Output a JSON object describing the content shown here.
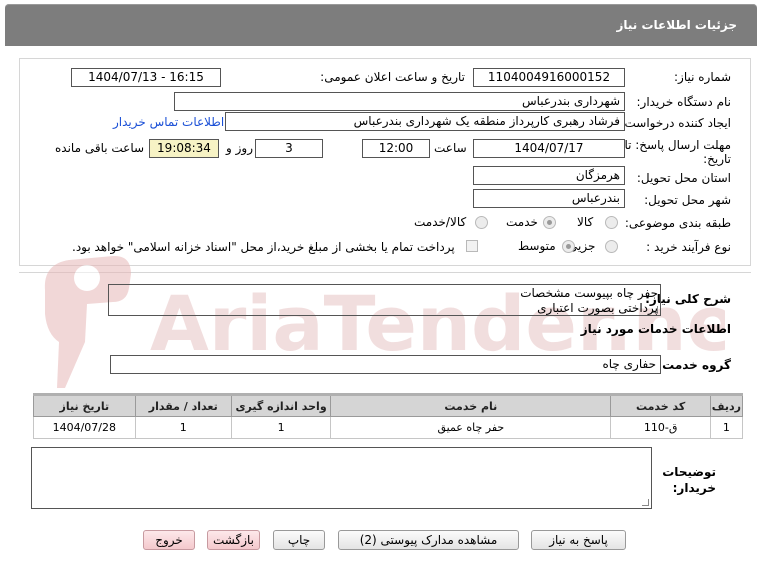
{
  "header": {
    "title": "جزئیات اطلاعات نیاز"
  },
  "form": {
    "need_number_label": "شماره نیاز:",
    "need_number": "1104004916000152",
    "announce_label": "تاریخ و ساعت اعلان عمومی:",
    "announce_value": "1404/07/13 - 16:15",
    "buyer_org_label": "نام دستگاه خریدار:",
    "buyer_org": "شهرداری بندرعباس",
    "creator_label": "ایجاد کننده درخواست:",
    "creator": "فرشاد رهبری کارپرداز منطقه یک شهرداری بندرعباس",
    "contact_link": "اطلاعات تماس خریدار",
    "deadline_label_1": "مهلت ارسال پاسخ: تا",
    "deadline_label_2": "تاریخ:",
    "deadline_date": "1404/07/17",
    "time_label": "ساعت",
    "deadline_time": "12:00",
    "days_value": "3",
    "days_label": "روز و",
    "remaining_time": "19:08:34",
    "remaining_label": "ساعت باقی مانده",
    "province_label": "استان محل تحویل:",
    "province": "هرمزگان",
    "city_label": "شهر محل تحویل:",
    "city": "بندرعباس",
    "category_label": "طبقه بندی موضوعی:",
    "category_options": [
      "کالا",
      "خدمت",
      "کالا/خدمت"
    ],
    "category_selected": "خدمت",
    "process_label": "نوع فرآیند خرید :",
    "process_options": [
      "جزیی",
      "متوسط"
    ],
    "process_selected": "متوسط",
    "payment_note": "پرداخت تمام یا بخشی از مبلغ خرید،از محل \"اسناد خزانه اسلامی\" خواهد بود."
  },
  "details": {
    "summary_label": "شرح کلی نیاز:",
    "summary_line1": "حفر چاه بپیوست مشخصات",
    "summary_line2": "پرداختی بصورت اعتباری",
    "services_title": "اطلاعات خدمات مورد نیاز",
    "group_label": "گروه خدمت:",
    "group_value": "حفاری چاه",
    "buyer_notes_label_1": "توضیحات",
    "buyer_notes_label_2": "خریدار:"
  },
  "table": {
    "headers": [
      "ردیف",
      "کد خدمت",
      "نام خدمت",
      "واحد اندازه گیری",
      "تعداد / مقدار",
      "تاریخ نیاز"
    ],
    "rows": [
      [
        "1",
        "ق-110",
        "حفر چاه عمیق",
        "1",
        "1",
        "1404/07/28"
      ]
    ]
  },
  "buttons": {
    "reply": "پاسخ به نیاز",
    "attachments": "مشاهده مدارک پیوستی (2)",
    "print": "چاپ",
    "back": "بازگشت",
    "exit": "خروج"
  },
  "watermark": {
    "text": "AriaTender.net"
  },
  "colors": {
    "header_bg": "#7d7d7d",
    "remaining_bg": "#f7f3c5",
    "link": "#1a4fd6",
    "exit_button_bg": "#f4c9cd"
  }
}
